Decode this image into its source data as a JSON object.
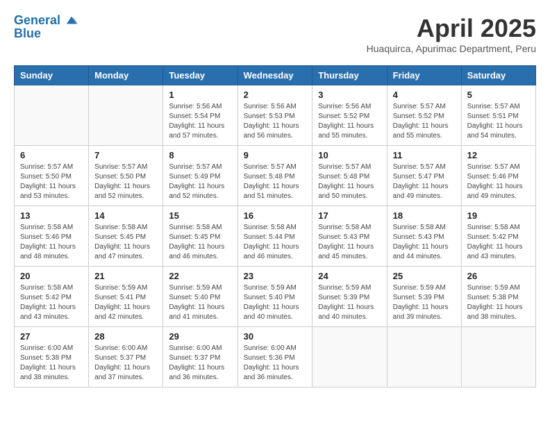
{
  "header": {
    "logo_line1": "General",
    "logo_line2": "Blue",
    "month": "April 2025",
    "location": "Huaquirca, Apurimac Department, Peru"
  },
  "days_of_week": [
    "Sunday",
    "Monday",
    "Tuesday",
    "Wednesday",
    "Thursday",
    "Friday",
    "Saturday"
  ],
  "weeks": [
    [
      {
        "day": "",
        "info": ""
      },
      {
        "day": "",
        "info": ""
      },
      {
        "day": "1",
        "info": "Sunrise: 5:56 AM\nSunset: 5:54 PM\nDaylight: 11 hours and 57 minutes."
      },
      {
        "day": "2",
        "info": "Sunrise: 5:56 AM\nSunset: 5:53 PM\nDaylight: 11 hours and 56 minutes."
      },
      {
        "day": "3",
        "info": "Sunrise: 5:56 AM\nSunset: 5:52 PM\nDaylight: 11 hours and 55 minutes."
      },
      {
        "day": "4",
        "info": "Sunrise: 5:57 AM\nSunset: 5:52 PM\nDaylight: 11 hours and 55 minutes."
      },
      {
        "day": "5",
        "info": "Sunrise: 5:57 AM\nSunset: 5:51 PM\nDaylight: 11 hours and 54 minutes."
      }
    ],
    [
      {
        "day": "6",
        "info": "Sunrise: 5:57 AM\nSunset: 5:50 PM\nDaylight: 11 hours and 53 minutes."
      },
      {
        "day": "7",
        "info": "Sunrise: 5:57 AM\nSunset: 5:50 PM\nDaylight: 11 hours and 52 minutes."
      },
      {
        "day": "8",
        "info": "Sunrise: 5:57 AM\nSunset: 5:49 PM\nDaylight: 11 hours and 52 minutes."
      },
      {
        "day": "9",
        "info": "Sunrise: 5:57 AM\nSunset: 5:48 PM\nDaylight: 11 hours and 51 minutes."
      },
      {
        "day": "10",
        "info": "Sunrise: 5:57 AM\nSunset: 5:48 PM\nDaylight: 11 hours and 50 minutes."
      },
      {
        "day": "11",
        "info": "Sunrise: 5:57 AM\nSunset: 5:47 PM\nDaylight: 11 hours and 49 minutes."
      },
      {
        "day": "12",
        "info": "Sunrise: 5:57 AM\nSunset: 5:46 PM\nDaylight: 11 hours and 49 minutes."
      }
    ],
    [
      {
        "day": "13",
        "info": "Sunrise: 5:58 AM\nSunset: 5:46 PM\nDaylight: 11 hours and 48 minutes."
      },
      {
        "day": "14",
        "info": "Sunrise: 5:58 AM\nSunset: 5:45 PM\nDaylight: 11 hours and 47 minutes."
      },
      {
        "day": "15",
        "info": "Sunrise: 5:58 AM\nSunset: 5:45 PM\nDaylight: 11 hours and 46 minutes."
      },
      {
        "day": "16",
        "info": "Sunrise: 5:58 AM\nSunset: 5:44 PM\nDaylight: 11 hours and 46 minutes."
      },
      {
        "day": "17",
        "info": "Sunrise: 5:58 AM\nSunset: 5:43 PM\nDaylight: 11 hours and 45 minutes."
      },
      {
        "day": "18",
        "info": "Sunrise: 5:58 AM\nSunset: 5:43 PM\nDaylight: 11 hours and 44 minutes."
      },
      {
        "day": "19",
        "info": "Sunrise: 5:58 AM\nSunset: 5:42 PM\nDaylight: 11 hours and 43 minutes."
      }
    ],
    [
      {
        "day": "20",
        "info": "Sunrise: 5:58 AM\nSunset: 5:42 PM\nDaylight: 11 hours and 43 minutes."
      },
      {
        "day": "21",
        "info": "Sunrise: 5:59 AM\nSunset: 5:41 PM\nDaylight: 11 hours and 42 minutes."
      },
      {
        "day": "22",
        "info": "Sunrise: 5:59 AM\nSunset: 5:40 PM\nDaylight: 11 hours and 41 minutes."
      },
      {
        "day": "23",
        "info": "Sunrise: 5:59 AM\nSunset: 5:40 PM\nDaylight: 11 hours and 40 minutes."
      },
      {
        "day": "24",
        "info": "Sunrise: 5:59 AM\nSunset: 5:39 PM\nDaylight: 11 hours and 40 minutes."
      },
      {
        "day": "25",
        "info": "Sunrise: 5:59 AM\nSunset: 5:39 PM\nDaylight: 11 hours and 39 minutes."
      },
      {
        "day": "26",
        "info": "Sunrise: 5:59 AM\nSunset: 5:38 PM\nDaylight: 11 hours and 38 minutes."
      }
    ],
    [
      {
        "day": "27",
        "info": "Sunrise: 6:00 AM\nSunset: 5:38 PM\nDaylight: 11 hours and 38 minutes."
      },
      {
        "day": "28",
        "info": "Sunrise: 6:00 AM\nSunset: 5:37 PM\nDaylight: 11 hours and 37 minutes."
      },
      {
        "day": "29",
        "info": "Sunrise: 6:00 AM\nSunset: 5:37 PM\nDaylight: 11 hours and 36 minutes."
      },
      {
        "day": "30",
        "info": "Sunrise: 6:00 AM\nSunset: 5:36 PM\nDaylight: 11 hours and 36 minutes."
      },
      {
        "day": "",
        "info": ""
      },
      {
        "day": "",
        "info": ""
      },
      {
        "day": "",
        "info": ""
      }
    ]
  ]
}
